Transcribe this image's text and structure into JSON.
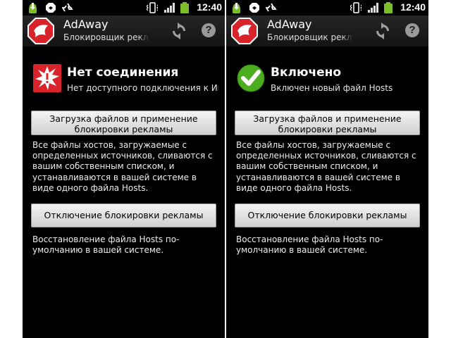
{
  "status_bar": {
    "time": "12:40"
  },
  "app": {
    "title": "AdAway",
    "subtitle": "Блокировщик рекламы"
  },
  "screens": [
    {
      "status_title": "Нет соединения",
      "status_desc": "Нет доступного подключения к Интернету",
      "status_icon": "error-icon"
    },
    {
      "status_title": "Включено",
      "status_desc": "Включен новый файл Hosts",
      "status_icon": "checkmark-icon"
    }
  ],
  "actions": {
    "apply_label": "Загрузка файлов и применение блокировки рекламы",
    "apply_desc": "Все файлы хостов, загружаемые с определенных источников, сливаются с вашим собственным списком, и устанавливаются в вашей системе в виде одного файла Hosts.",
    "disable_label": "Отключение блокировки рекламы",
    "disable_desc": "Восстановление файла Hosts по-умолчанию в вашей системе."
  },
  "colors": {
    "app_icon_red": "#d8232a",
    "error_red": "#d8242a",
    "success_green": "#4cad1e"
  }
}
